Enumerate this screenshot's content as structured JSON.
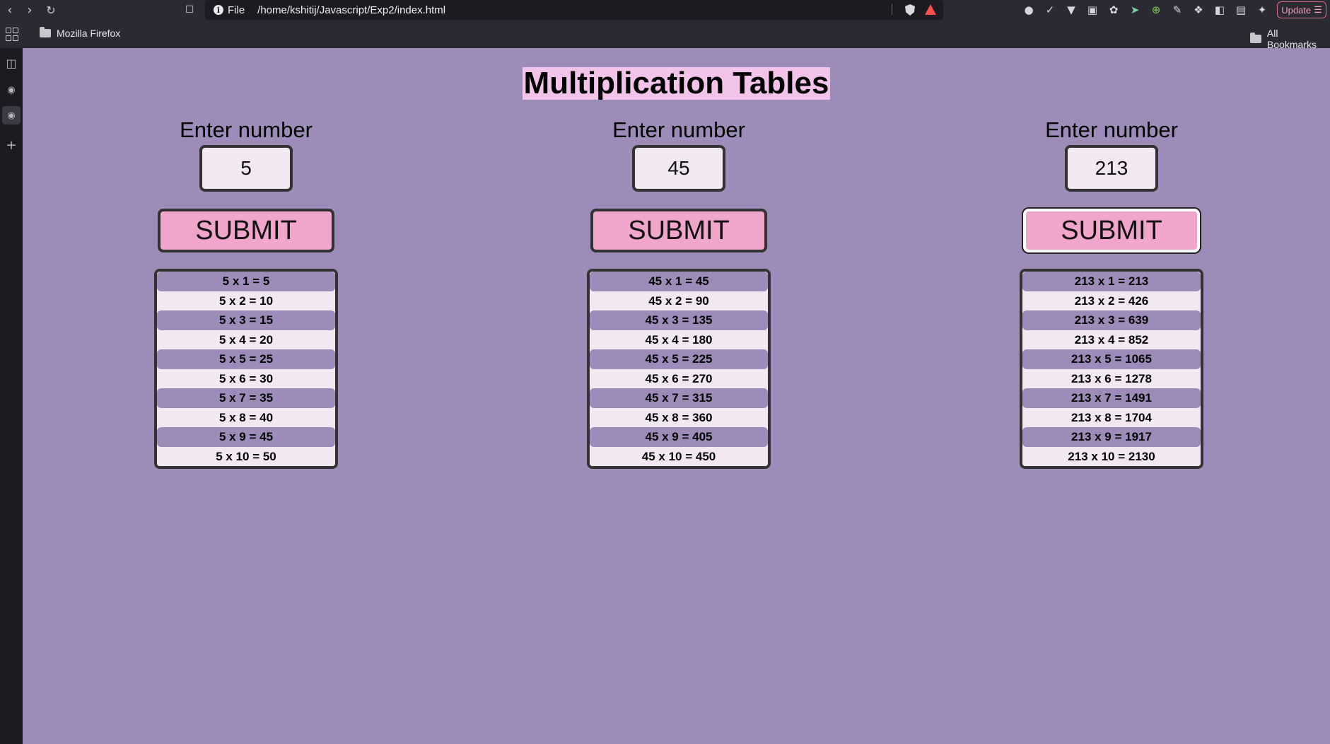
{
  "browser": {
    "url_scheme": "File",
    "url_path": "/home/kshitij/Javascript/Exp2/index.html",
    "bookmark_folder": "Mozilla Firefox",
    "all_bookmarks": "All Bookmarks",
    "update_label": "Update"
  },
  "page": {
    "title": "Multiplication Tables",
    "background": "#9d8bb9"
  },
  "columns": [
    {
      "label": "Enter number",
      "input_value": "5",
      "submit_label": "SUBMIT",
      "rows": [
        "5 x 1 = 5",
        "5 x 2 = 10",
        "5 x 3 = 15",
        "5 x 4 = 20",
        "5 x 5 = 25",
        "5 x 6 = 30",
        "5 x 7 = 35",
        "5 x 8 = 40",
        "5 x 9 = 45",
        "5 x 10 = 50"
      ]
    },
    {
      "label": "Enter number",
      "input_value": "45",
      "submit_label": "SUBMIT",
      "rows": [
        "45 x 1 = 45",
        "45 x 2 = 90",
        "45 x 3 = 135",
        "45 x 4 = 180",
        "45 x 5 = 225",
        "45 x 6 = 270",
        "45 x 7 = 315",
        "45 x 8 = 360",
        "45 x 9 = 405",
        "45 x 10 = 450"
      ]
    },
    {
      "label": "Enter number",
      "input_value": "213",
      "submit_label": "SUBMIT",
      "rows": [
        "213 x 1 = 213",
        "213 x 2 = 426",
        "213 x 3 = 639",
        "213 x 4 = 852",
        "213 x 5 = 1065",
        "213 x 6 = 1278",
        "213 x 7 = 1491",
        "213 x 8 = 1704",
        "213 x 9 = 1917",
        "213 x 10 = 2130"
      ]
    }
  ]
}
